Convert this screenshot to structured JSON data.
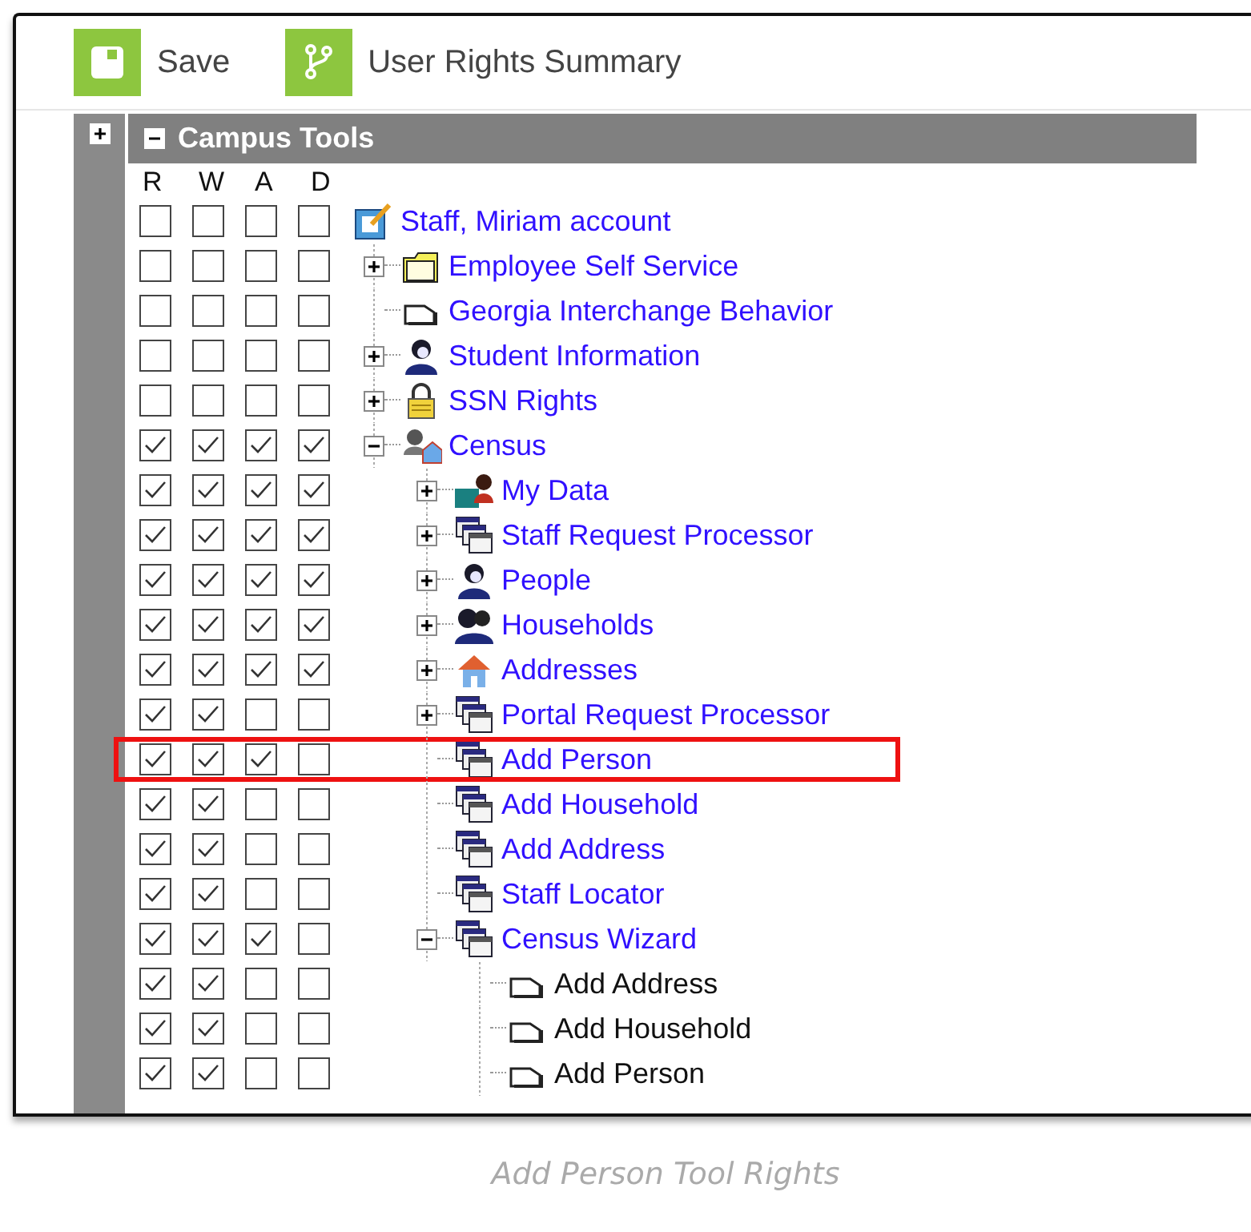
{
  "toolbar": [
    {
      "kind": "save",
      "label": "Save"
    },
    {
      "kind": "summary",
      "label": "User Rights Summary"
    }
  ],
  "panel": {
    "title": "Campus Tools",
    "expanded": true,
    "side_expanded": false
  },
  "columns": [
    "R",
    "W",
    "A",
    "D"
  ],
  "tree": {
    "label": "Staff, Miriam account",
    "kind": "account",
    "rights": [
      false,
      false,
      false,
      false
    ],
    "children": [
      {
        "label": "Employee Self Service",
        "kind": "folder",
        "expanded": false,
        "rights": [
          false,
          false,
          false,
          false
        ]
      },
      {
        "label": "Georgia Interchange Behavior",
        "kind": "page",
        "rights": [
          false,
          false,
          false,
          false
        ]
      },
      {
        "label": "Student Information",
        "kind": "person",
        "expanded": false,
        "rights": [
          false,
          false,
          false,
          false
        ]
      },
      {
        "label": "SSN Rights",
        "kind": "lock",
        "expanded": false,
        "rights": [
          false,
          false,
          false,
          false
        ]
      },
      {
        "label": "Census",
        "kind": "census",
        "expanded": true,
        "rights": [
          true,
          true,
          true,
          true
        ],
        "children": [
          {
            "label": "My Data",
            "kind": "mydata",
            "expanded": false,
            "rights": [
              true,
              true,
              true,
              true
            ]
          },
          {
            "label": "Staff Request Processor",
            "kind": "windows",
            "expanded": false,
            "rights": [
              true,
              true,
              true,
              true
            ]
          },
          {
            "label": "People",
            "kind": "person",
            "expanded": false,
            "rights": [
              true,
              true,
              true,
              true
            ]
          },
          {
            "label": "Households",
            "kind": "people",
            "expanded": false,
            "rights": [
              true,
              true,
              true,
              true
            ]
          },
          {
            "label": "Addresses",
            "kind": "house",
            "expanded": false,
            "rights": [
              true,
              true,
              true,
              true
            ]
          },
          {
            "label": "Portal Request Processor",
            "kind": "windows",
            "expanded": false,
            "rights": [
              true,
              true,
              false,
              false
            ]
          },
          {
            "label": "Add Person",
            "kind": "windows",
            "highlighted": true,
            "rights": [
              true,
              true,
              true,
              false
            ]
          },
          {
            "label": "Add Household",
            "kind": "windows",
            "rights": [
              true,
              true,
              false,
              false
            ]
          },
          {
            "label": "Add Address",
            "kind": "windows",
            "rights": [
              true,
              true,
              false,
              false
            ]
          },
          {
            "label": "Staff Locator",
            "kind": "windows",
            "rights": [
              true,
              true,
              false,
              false
            ]
          },
          {
            "label": "Census Wizard",
            "kind": "windows",
            "expanded": true,
            "rights": [
              true,
              true,
              true,
              false
            ],
            "children": [
              {
                "label": "Add Address",
                "kind": "task",
                "rights": [
                  true,
                  true,
                  false,
                  false
                ]
              },
              {
                "label": "Add Household",
                "kind": "task",
                "rights": [
                  true,
                  true,
                  false,
                  false
                ]
              },
              {
                "label": "Add Person",
                "kind": "task",
                "rights": [
                  true,
                  true,
                  false,
                  false
                ]
              }
            ]
          }
        ]
      }
    ]
  },
  "caption": "Add Person Tool Rights"
}
